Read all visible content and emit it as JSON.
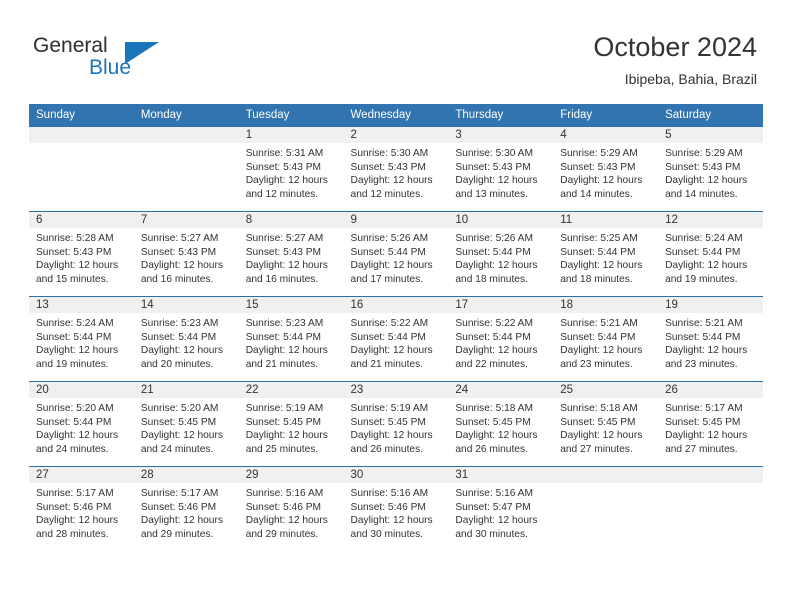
{
  "brand": {
    "word_one": "General",
    "word_two": "Blue",
    "accent_color": "#1b75bb"
  },
  "header": {
    "title": "October 2024",
    "subtitle": "Ibipeba, Bahia, Brazil"
  },
  "calendar": {
    "header_bg": "#3174b0",
    "daystrip_bg": "#f0f0f0",
    "weekday_names": [
      "Sunday",
      "Monday",
      "Tuesday",
      "Wednesday",
      "Thursday",
      "Friday",
      "Saturday"
    ],
    "weeks": [
      [
        {
          "day": "",
          "sunrise": "",
          "sunset": "",
          "daylight_line1": "",
          "daylight_line2": ""
        },
        {
          "day": "",
          "sunrise": "",
          "sunset": "",
          "daylight_line1": "",
          "daylight_line2": ""
        },
        {
          "day": "1",
          "sunrise": "Sunrise: 5:31 AM",
          "sunset": "Sunset: 5:43 PM",
          "daylight_line1": "Daylight: 12 hours",
          "daylight_line2": "and 12 minutes."
        },
        {
          "day": "2",
          "sunrise": "Sunrise: 5:30 AM",
          "sunset": "Sunset: 5:43 PM",
          "daylight_line1": "Daylight: 12 hours",
          "daylight_line2": "and 12 minutes."
        },
        {
          "day": "3",
          "sunrise": "Sunrise: 5:30 AM",
          "sunset": "Sunset: 5:43 PM",
          "daylight_line1": "Daylight: 12 hours",
          "daylight_line2": "and 13 minutes."
        },
        {
          "day": "4",
          "sunrise": "Sunrise: 5:29 AM",
          "sunset": "Sunset: 5:43 PM",
          "daylight_line1": "Daylight: 12 hours",
          "daylight_line2": "and 14 minutes."
        },
        {
          "day": "5",
          "sunrise": "Sunrise: 5:29 AM",
          "sunset": "Sunset: 5:43 PM",
          "daylight_line1": "Daylight: 12 hours",
          "daylight_line2": "and 14 minutes."
        }
      ],
      [
        {
          "day": "6",
          "sunrise": "Sunrise: 5:28 AM",
          "sunset": "Sunset: 5:43 PM",
          "daylight_line1": "Daylight: 12 hours",
          "daylight_line2": "and 15 minutes."
        },
        {
          "day": "7",
          "sunrise": "Sunrise: 5:27 AM",
          "sunset": "Sunset: 5:43 PM",
          "daylight_line1": "Daylight: 12 hours",
          "daylight_line2": "and 16 minutes."
        },
        {
          "day": "8",
          "sunrise": "Sunrise: 5:27 AM",
          "sunset": "Sunset: 5:43 PM",
          "daylight_line1": "Daylight: 12 hours",
          "daylight_line2": "and 16 minutes."
        },
        {
          "day": "9",
          "sunrise": "Sunrise: 5:26 AM",
          "sunset": "Sunset: 5:44 PM",
          "daylight_line1": "Daylight: 12 hours",
          "daylight_line2": "and 17 minutes."
        },
        {
          "day": "10",
          "sunrise": "Sunrise: 5:26 AM",
          "sunset": "Sunset: 5:44 PM",
          "daylight_line1": "Daylight: 12 hours",
          "daylight_line2": "and 18 minutes."
        },
        {
          "day": "11",
          "sunrise": "Sunrise: 5:25 AM",
          "sunset": "Sunset: 5:44 PM",
          "daylight_line1": "Daylight: 12 hours",
          "daylight_line2": "and 18 minutes."
        },
        {
          "day": "12",
          "sunrise": "Sunrise: 5:24 AM",
          "sunset": "Sunset: 5:44 PM",
          "daylight_line1": "Daylight: 12 hours",
          "daylight_line2": "and 19 minutes."
        }
      ],
      [
        {
          "day": "13",
          "sunrise": "Sunrise: 5:24 AM",
          "sunset": "Sunset: 5:44 PM",
          "daylight_line1": "Daylight: 12 hours",
          "daylight_line2": "and 19 minutes."
        },
        {
          "day": "14",
          "sunrise": "Sunrise: 5:23 AM",
          "sunset": "Sunset: 5:44 PM",
          "daylight_line1": "Daylight: 12 hours",
          "daylight_line2": "and 20 minutes."
        },
        {
          "day": "15",
          "sunrise": "Sunrise: 5:23 AM",
          "sunset": "Sunset: 5:44 PM",
          "daylight_line1": "Daylight: 12 hours",
          "daylight_line2": "and 21 minutes."
        },
        {
          "day": "16",
          "sunrise": "Sunrise: 5:22 AM",
          "sunset": "Sunset: 5:44 PM",
          "daylight_line1": "Daylight: 12 hours",
          "daylight_line2": "and 21 minutes."
        },
        {
          "day": "17",
          "sunrise": "Sunrise: 5:22 AM",
          "sunset": "Sunset: 5:44 PM",
          "daylight_line1": "Daylight: 12 hours",
          "daylight_line2": "and 22 minutes."
        },
        {
          "day": "18",
          "sunrise": "Sunrise: 5:21 AM",
          "sunset": "Sunset: 5:44 PM",
          "daylight_line1": "Daylight: 12 hours",
          "daylight_line2": "and 23 minutes."
        },
        {
          "day": "19",
          "sunrise": "Sunrise: 5:21 AM",
          "sunset": "Sunset: 5:44 PM",
          "daylight_line1": "Daylight: 12 hours",
          "daylight_line2": "and 23 minutes."
        }
      ],
      [
        {
          "day": "20",
          "sunrise": "Sunrise: 5:20 AM",
          "sunset": "Sunset: 5:44 PM",
          "daylight_line1": "Daylight: 12 hours",
          "daylight_line2": "and 24 minutes."
        },
        {
          "day": "21",
          "sunrise": "Sunrise: 5:20 AM",
          "sunset": "Sunset: 5:45 PM",
          "daylight_line1": "Daylight: 12 hours",
          "daylight_line2": "and 24 minutes."
        },
        {
          "day": "22",
          "sunrise": "Sunrise: 5:19 AM",
          "sunset": "Sunset: 5:45 PM",
          "daylight_line1": "Daylight: 12 hours",
          "daylight_line2": "and 25 minutes."
        },
        {
          "day": "23",
          "sunrise": "Sunrise: 5:19 AM",
          "sunset": "Sunset: 5:45 PM",
          "daylight_line1": "Daylight: 12 hours",
          "daylight_line2": "and 26 minutes."
        },
        {
          "day": "24",
          "sunrise": "Sunrise: 5:18 AM",
          "sunset": "Sunset: 5:45 PM",
          "daylight_line1": "Daylight: 12 hours",
          "daylight_line2": "and 26 minutes."
        },
        {
          "day": "25",
          "sunrise": "Sunrise: 5:18 AM",
          "sunset": "Sunset: 5:45 PM",
          "daylight_line1": "Daylight: 12 hours",
          "daylight_line2": "and 27 minutes."
        },
        {
          "day": "26",
          "sunrise": "Sunrise: 5:17 AM",
          "sunset": "Sunset: 5:45 PM",
          "daylight_line1": "Daylight: 12 hours",
          "daylight_line2": "and 27 minutes."
        }
      ],
      [
        {
          "day": "27",
          "sunrise": "Sunrise: 5:17 AM",
          "sunset": "Sunset: 5:46 PM",
          "daylight_line1": "Daylight: 12 hours",
          "daylight_line2": "and 28 minutes."
        },
        {
          "day": "28",
          "sunrise": "Sunrise: 5:17 AM",
          "sunset": "Sunset: 5:46 PM",
          "daylight_line1": "Daylight: 12 hours",
          "daylight_line2": "and 29 minutes."
        },
        {
          "day": "29",
          "sunrise": "Sunrise: 5:16 AM",
          "sunset": "Sunset: 5:46 PM",
          "daylight_line1": "Daylight: 12 hours",
          "daylight_line2": "and 29 minutes."
        },
        {
          "day": "30",
          "sunrise": "Sunrise: 5:16 AM",
          "sunset": "Sunset: 5:46 PM",
          "daylight_line1": "Daylight: 12 hours",
          "daylight_line2": "and 30 minutes."
        },
        {
          "day": "31",
          "sunrise": "Sunrise: 5:16 AM",
          "sunset": "Sunset: 5:47 PM",
          "daylight_line1": "Daylight: 12 hours",
          "daylight_line2": "and 30 minutes."
        },
        {
          "day": "",
          "sunrise": "",
          "sunset": "",
          "daylight_line1": "",
          "daylight_line2": ""
        },
        {
          "day": "",
          "sunrise": "",
          "sunset": "",
          "daylight_line1": "",
          "daylight_line2": ""
        }
      ]
    ]
  }
}
